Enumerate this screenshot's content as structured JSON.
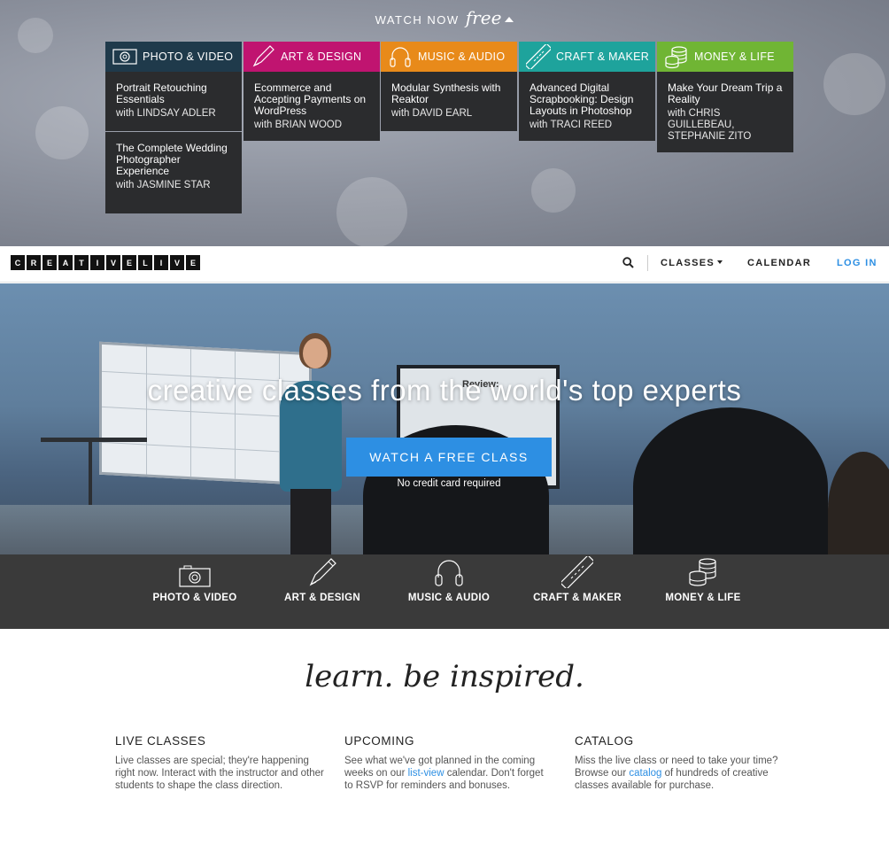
{
  "top_panel": {
    "watch_label": "WATCH NOW",
    "free_label": "free",
    "categories": [
      {
        "name": "PHOTO & VIDEO",
        "color": "#1f3a4b",
        "icon": "camera-icon",
        "cards": [
          {
            "title": "Portrait Retouching Essentials",
            "instructor": "with LINDSAY ADLER"
          },
          {
            "title": "The Complete Wedding Photographer Experience",
            "instructor": "with JASMINE STAR"
          }
        ]
      },
      {
        "name": "ART & DESIGN",
        "color": "#c01470",
        "icon": "pen-icon",
        "cards": [
          {
            "title": "Ecommerce and Accepting Payments on WordPress",
            "instructor": "with BRIAN WOOD"
          }
        ]
      },
      {
        "name": "MUSIC & AUDIO",
        "color": "#e88a1a",
        "icon": "headphones-icon",
        "cards": [
          {
            "title": "Modular Synthesis with Reaktor",
            "instructor": "with DAVID EARL"
          }
        ]
      },
      {
        "name": "CRAFT & MAKER",
        "color": "#1ea39c",
        "icon": "ruler-icon",
        "cards": [
          {
            "title": "Advanced Digital Scrapbooking: Design Layouts in Photoshop",
            "instructor": "with TRACI REED"
          }
        ]
      },
      {
        "name": "MONEY & LIFE",
        "color": "#70b534",
        "icon": "coins-icon",
        "cards": [
          {
            "title": "Make Your Dream Trip a Reality",
            "instructor": "with CHRIS GUILLEBEAU, STEPHANIE ZITO"
          }
        ]
      }
    ]
  },
  "navbar": {
    "logo_letters": [
      "C",
      "R",
      "E",
      "A",
      "T",
      "I",
      "V",
      "E",
      "L",
      "I",
      "V",
      "E"
    ],
    "classes_label": "CLASSES",
    "calendar_label": "CALENDAR",
    "login_label": "LOG IN",
    "accent_color": "#2d8fe3"
  },
  "hero": {
    "title": "creative classes from the world's top experts",
    "cta_label": "WATCH A FREE CLASS",
    "note": "No credit card required",
    "monitor_text": "Review:"
  },
  "category_bar": [
    {
      "label": "PHOTO & VIDEO",
      "icon": "camera-icon"
    },
    {
      "label": "ART & DESIGN",
      "icon": "pen-icon"
    },
    {
      "label": "MUSIC & AUDIO",
      "icon": "headphones-icon"
    },
    {
      "label": "CRAFT & MAKER",
      "icon": "ruler-icon"
    },
    {
      "label": "MONEY & LIFE",
      "icon": "coins-icon"
    }
  ],
  "tagline": "learn. be inspired.",
  "columns": {
    "live": {
      "heading": "LIVE CLASSES",
      "text": "Live classes are special; they're happening right now. Interact with the instructor and other students to shape the class direction."
    },
    "upcoming": {
      "heading": "UPCOMING",
      "text_before": "See what we've got planned in the coming weeks on our ",
      "link": "list-view",
      "text_after": " calendar. Don't forget to RSVP for reminders and bonuses."
    },
    "catalog": {
      "heading": "CATALOG",
      "text_before": "Miss the live class or need to take your time? Browse our ",
      "link": "catalog",
      "text_after": " of hundreds of creative classes available for purchase."
    }
  }
}
